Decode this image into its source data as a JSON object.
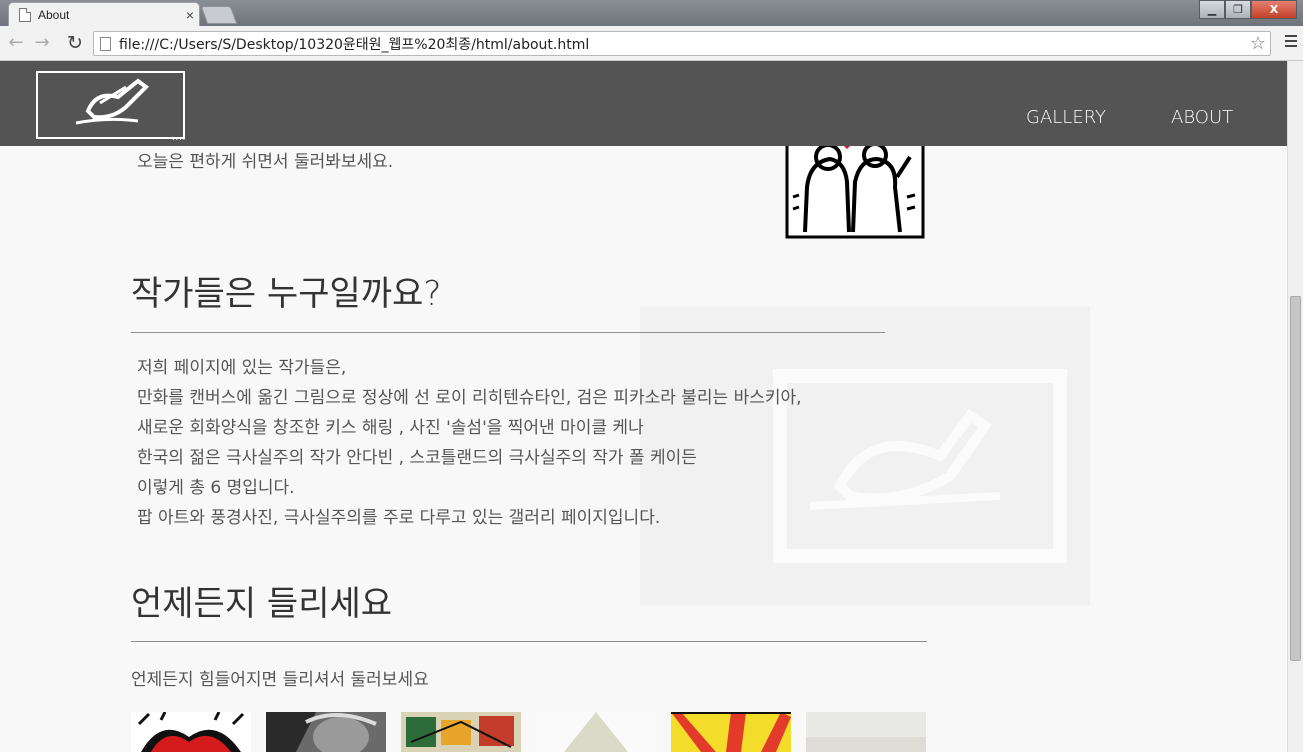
{
  "browser": {
    "tab_title": "About",
    "tab_close": "×",
    "url": "file:///C:/Users/S/Desktop/10320윤태원_웹프%20최종/html/about.html",
    "window_controls": {
      "minimize": "▁",
      "maximize": "❐",
      "close": "X"
    },
    "icons": [
      "page-icon",
      "back-arrow-icon",
      "forward-arrow-icon",
      "reload-icon",
      "bookmark-star-icon",
      "menu-icon"
    ]
  },
  "header": {
    "logo_dots": "....",
    "nav": [
      {
        "label": "GALLERY"
      },
      {
        "label": "ABOUT"
      }
    ]
  },
  "intro": {
    "line": "오늘은 편하게 쉬면서 둘러봐보세요."
  },
  "section_artists": {
    "title": "작가들은 누구일까요?",
    "lines": [
      "저희 페이지에 있는 작가들은,",
      "만화를 캔버스에 옮긴 그림으로 정상에 선 로이 리히텐슈타인, 검은 피카소라 불리는 바스키아,",
      "새로운 회화양식을 창조한 키스 해링 , 사진 '솔섬'을 찍어낸 마이클 케나",
      "한국의 젊은 극사실주의 작가 안다빈 , 스코틀랜드의 극사실주의 작가 폴 케이든",
      "이렇게 총 6 명입니다.",
      "팝 아트와 풍경사진, 극사실주의를 주로 다루고 있는 갤러리 페이지입니다."
    ]
  },
  "section_visit": {
    "title": "언제든지 들리세요",
    "subtitle": "언제든지 힘들어지면 들리셔서 둘러보세요"
  },
  "colors": {
    "header_bg": "#545454",
    "page_bg": "#f8f8f8",
    "text": "#555555",
    "heading": "#333333"
  }
}
